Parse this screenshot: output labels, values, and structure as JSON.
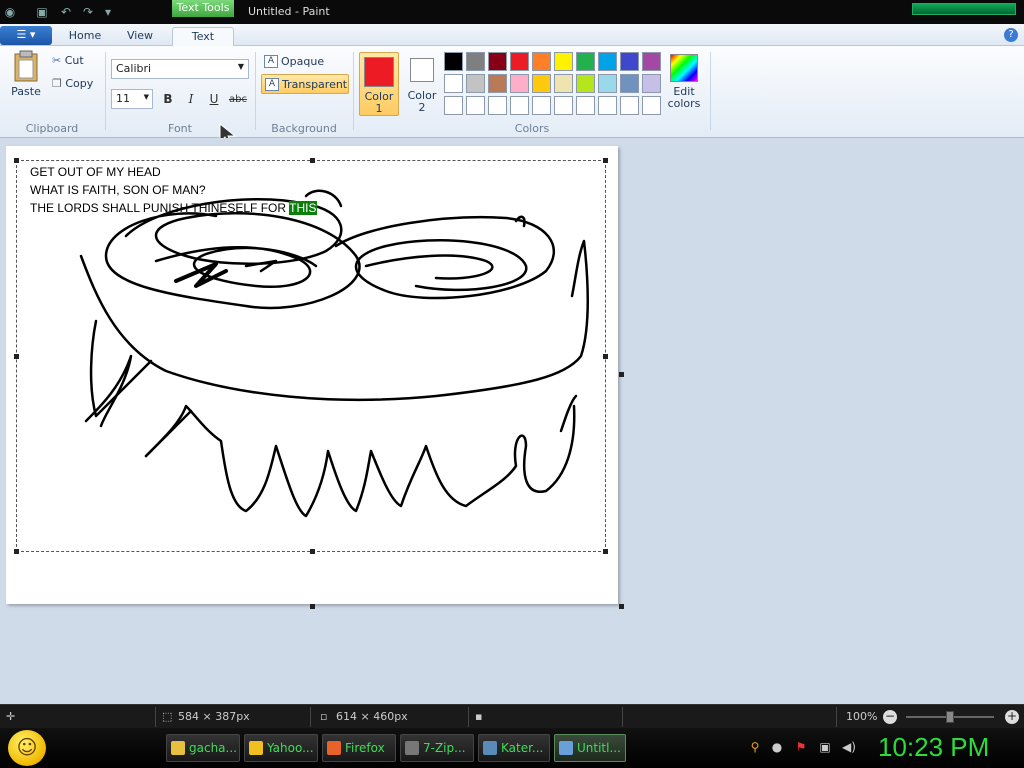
{
  "window": {
    "title": "Untitled - Paint",
    "context_tab": "Text Tools"
  },
  "tabs": [
    "Home",
    "View",
    "Text"
  ],
  "active_tab": "Text",
  "ribbon": {
    "clipboard": {
      "paste": "Paste",
      "cut": "Cut",
      "copy": "Copy",
      "label": "Clipboard"
    },
    "font": {
      "family": "Calibri",
      "size": "11",
      "bold": "B",
      "italic": "I",
      "underline": "U",
      "strike": "abc",
      "label": "Font"
    },
    "background": {
      "opaque": "Opaque",
      "transparent": "Transparent",
      "label": "Background",
      "selected": "Transparent"
    },
    "colors": {
      "color1_label": "Color\n1",
      "color1_a": "Color",
      "color1_b": "1",
      "color2_a": "Color",
      "color2_b": "2",
      "color1_value": "#ed1c24",
      "color2_value": "#ffffff",
      "edit_a": "Edit",
      "edit_b": "colors",
      "label": "Colors",
      "palette_row1": [
        "#000000",
        "#7f7f7f",
        "#880015",
        "#ed1c24",
        "#ff7f27",
        "#fff200",
        "#22b14c",
        "#00a2e8",
        "#3f48cc",
        "#a349a4"
      ],
      "palette_row2": [
        "#ffffff",
        "#c3c3c3",
        "#b97a57",
        "#ffaec9",
        "#ffc90e",
        "#efe4b0",
        "#b5e61d",
        "#99d9ea",
        "#7092be",
        "#c8bfe7"
      ],
      "palette_row3": [
        "#ffffff",
        "#ffffff",
        "#ffffff",
        "#ffffff",
        "#ffffff",
        "#ffffff",
        "#ffffff",
        "#ffffff",
        "#ffffff",
        "#ffffff"
      ]
    }
  },
  "canvas": {
    "lines": [
      "GET OUT OF MY HEAD",
      "WHAT IS FAITH, SON OF MAN?",
      "THE LORDS SHALL PUNISH THINESELF FOR "
    ],
    "highlighted_word": "THIS",
    "highlight_color": "#0a7f0a"
  },
  "status": {
    "selection_size": "584 × 387px",
    "image_size": "614 × 460px",
    "zoom": "100%"
  },
  "taskbar": {
    "tasks": [
      {
        "label": "gacha...",
        "icon_color": "#e8c040"
      },
      {
        "label": "Yahoo...",
        "icon_color": "#f0c020"
      },
      {
        "label": "Firefox",
        "icon_color": "#e8622a"
      },
      {
        "label": "7-Zip...",
        "icon_color": "#777777"
      },
      {
        "label": "Kater...",
        "icon_color": "#5a8ab8"
      },
      {
        "label": "Untitl...",
        "icon_color": "#6aa0d8"
      }
    ],
    "clock": "10:23 PM"
  }
}
